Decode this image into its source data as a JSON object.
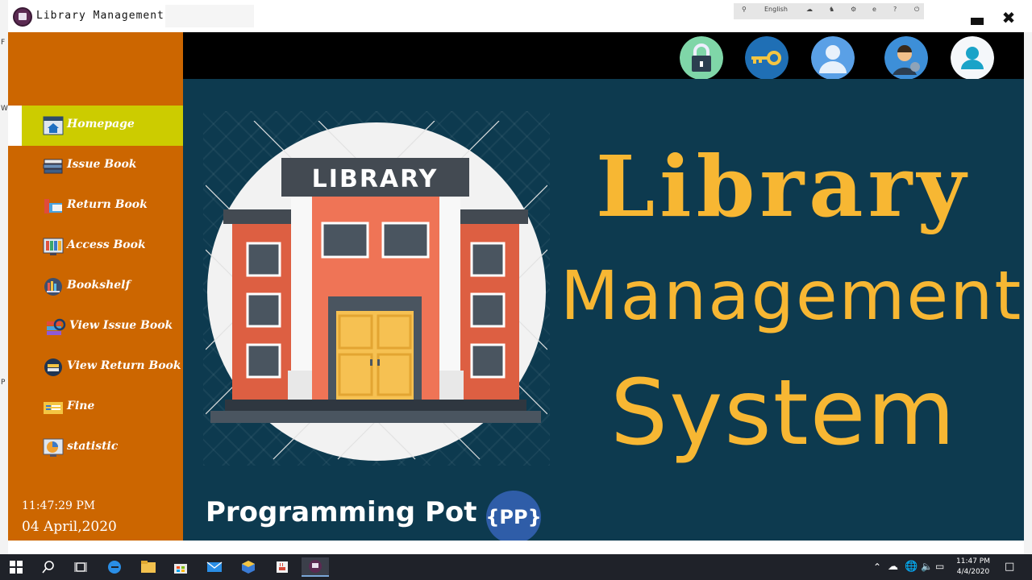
{
  "window": {
    "title": "Library Management System",
    "lang_label": "English"
  },
  "sidebar": {
    "items": [
      {
        "label": "Homepage",
        "icon": "home-icon",
        "active": true
      },
      {
        "label": "Issue Book",
        "icon": "books-stack-icon"
      },
      {
        "label": "Return Book",
        "icon": "return-book-icon"
      },
      {
        "label": "Access Book",
        "icon": "access-book-icon"
      },
      {
        "label": "Bookshelf",
        "icon": "bookshelf-icon"
      },
      {
        "label": "View Issue Book",
        "icon": "view-issue-icon"
      },
      {
        "label": "View Return Book",
        "icon": "view-return-icon"
      },
      {
        "label": "Fine",
        "icon": "fine-icon"
      },
      {
        "label": "statistic",
        "icon": "statistic-icon"
      }
    ],
    "time": "11:47:29 PM",
    "date": "04 April,2020"
  },
  "topbar": {
    "buttons": [
      {
        "name": "lock-button",
        "icon": "lock-icon"
      },
      {
        "name": "key-button",
        "icon": "key-icon"
      },
      {
        "name": "user-button",
        "icon": "user-icon"
      },
      {
        "name": "admin-button",
        "icon": "admin-user-icon"
      },
      {
        "name": "profile-button",
        "icon": "profile-icon"
      }
    ]
  },
  "banner": {
    "sign": "LIBRARY",
    "line1": "Library",
    "line2": "Management",
    "line3": "System",
    "brand": "Programming Pot",
    "badge": "{PP}"
  },
  "taskbar": {
    "time": "11:47 PM",
    "date": "4/4/2020"
  },
  "colors": {
    "sidebar": "#cc6600",
    "active_item": "#cccc00",
    "banner_bg": "#0d3a4f",
    "title_text": "#f7b733"
  }
}
